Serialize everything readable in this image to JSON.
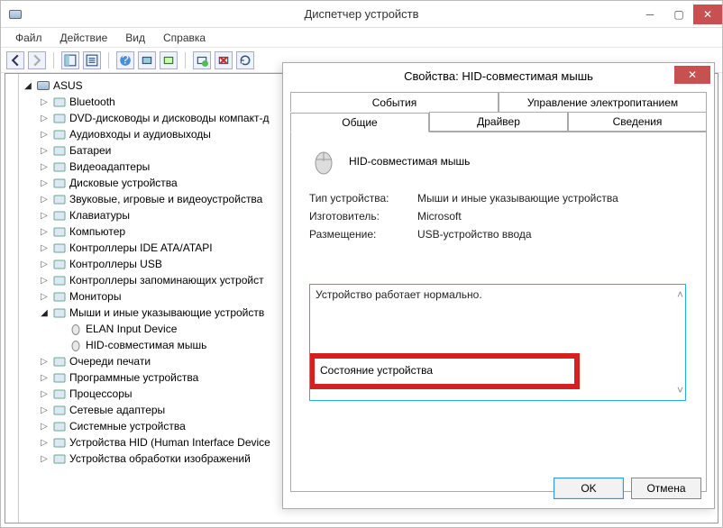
{
  "window": {
    "title": "Диспетчер устройств"
  },
  "menu": [
    "Файл",
    "Действие",
    "Вид",
    "Справка"
  ],
  "tree": {
    "root": "ASUS",
    "items": [
      {
        "label": "Bluetooth"
      },
      {
        "label": "DVD-дисководы и дисководы компакт-д"
      },
      {
        "label": "Аудиовходы и аудиовыходы"
      },
      {
        "label": "Батареи"
      },
      {
        "label": "Видеоадаптеры"
      },
      {
        "label": "Дисковые устройства"
      },
      {
        "label": "Звуковые, игровые и видеоустройства"
      },
      {
        "label": "Клавиатуры"
      },
      {
        "label": "Компьютер"
      },
      {
        "label": "Контроллеры IDE ATA/ATAPI"
      },
      {
        "label": "Контроллеры USB"
      },
      {
        "label": "Контроллеры запоминающих устройст"
      },
      {
        "label": "Мониторы"
      },
      {
        "label": "Мыши и иные указывающие устройств",
        "open": true,
        "children": [
          {
            "label": "ELAN Input Device"
          },
          {
            "label": "HID-совместимая мышь"
          }
        ]
      },
      {
        "label": "Очереди печати"
      },
      {
        "label": "Программные устройства"
      },
      {
        "label": "Процессоры"
      },
      {
        "label": "Сетевые адаптеры"
      },
      {
        "label": "Системные устройства"
      },
      {
        "label": "Устройства HID (Human Interface Device"
      },
      {
        "label": "Устройства обработки изображений"
      }
    ]
  },
  "dialog": {
    "title": "Свойства: HID-совместимая мышь",
    "tabs_top": [
      "События",
      "Управление электропитанием"
    ],
    "tabs_bot": [
      "Общие",
      "Драйвер",
      "Сведения"
    ],
    "active_tab": "Общие",
    "device_name": "HID-совместимая мышь",
    "props": {
      "type_label": "Тип устройства:",
      "type_value": "Мыши и иные указывающие устройства",
      "mfg_label": "Изготовитель:",
      "mfg_value": "Microsoft",
      "loc_label": "Размещение:",
      "loc_value": "USB-устройство ввода"
    },
    "status_label": "Состояние устройства",
    "status_text": "Устройство работает нормально.",
    "ok": "OK",
    "cancel": "Отмена"
  }
}
